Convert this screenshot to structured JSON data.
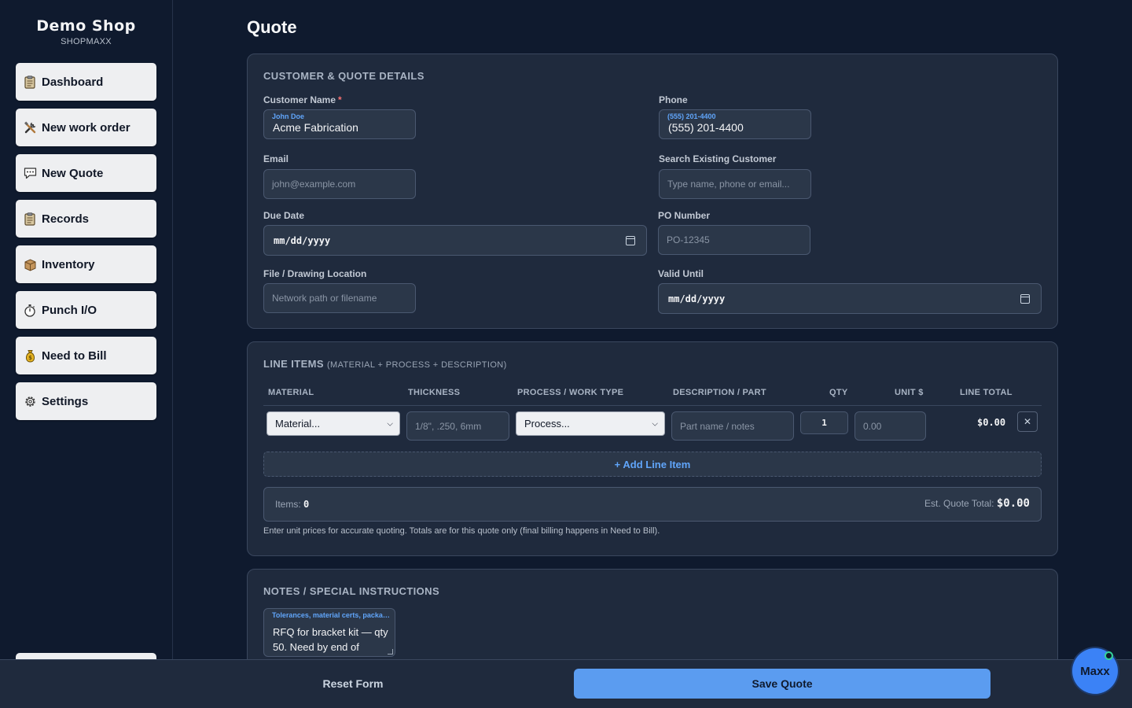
{
  "brand": {
    "title": "Demo Shop",
    "subtitle": "SHOPMAXX"
  },
  "sidebar": {
    "items": [
      {
        "label": "Dashboard",
        "icon": "clipboard-icon"
      },
      {
        "label": "New work order",
        "icon": "tools-icon"
      },
      {
        "label": "New Quote",
        "icon": "speech-bubble-icon"
      },
      {
        "label": "Records",
        "icon": "clipboard-icon"
      },
      {
        "label": "Inventory",
        "icon": "box-icon"
      },
      {
        "label": "Punch I/O",
        "icon": "stopwatch-icon"
      },
      {
        "label": "Need to Bill",
        "icon": "money-bag-icon"
      },
      {
        "label": "Settings",
        "icon": "gear-icon"
      }
    ]
  },
  "page": {
    "title": "Quote"
  },
  "customer": {
    "section_title": "CUSTOMER & QUOTE DETAILS",
    "name_label": "Customer Name",
    "required_mark": "*",
    "name_placeholder": "John Doe",
    "name_value": "Acme Fabrication",
    "phone_label": "Phone",
    "phone_placeholder": "(555) 201-4400",
    "phone_value": "(555) 201-4400",
    "email_label": "Email",
    "email_placeholder": "john@example.com",
    "search_label": "Search Existing Customer",
    "search_placeholder": "Type name, phone or email...",
    "due_label": "Due Date",
    "due_value": "mm/dd/yyyy",
    "po_label": "PO Number",
    "po_placeholder": "PO-12345",
    "file_label": "File / Drawing Location",
    "file_placeholder": "Network path or filename",
    "valid_label": "Valid Until",
    "valid_value": "mm/dd/yyyy"
  },
  "line_items": {
    "section_title": "LINE ITEMS",
    "section_sub": "(MATERIAL + PROCESS + DESCRIPTION)",
    "columns": [
      "MATERIAL",
      "THICKNESS",
      "PROCESS / WORK TYPE",
      "DESCRIPTION / PART",
      "QTY",
      "UNIT $",
      "LINE TOTAL"
    ],
    "row": {
      "material": "Material...",
      "thickness_placeholder": "1/8\", .250, 6mm",
      "process": "Process...",
      "description_placeholder": "Part name / notes",
      "qty": "1",
      "unit_placeholder": "0.00",
      "line_total": "$0.00",
      "remove": "✕"
    },
    "add_label": "+ Add Line Item",
    "items_label": "Items:",
    "items_count": "0",
    "total_label": "Est. Quote Total:",
    "total_value": "$0.00",
    "help": "Enter unit prices for accurate quoting. Totals are for this quote only (final billing happens in Need to Bill)."
  },
  "notes": {
    "section_title": "NOTES / SPECIAL INSTRUCTIONS",
    "placeholder": "Tolerances, material certs, packaging...",
    "value": "RFQ for bracket kit — qty 50. Need by end of"
  },
  "footer": {
    "reset_label": "Reset Form",
    "save_label": "Save Quote"
  },
  "assistant": {
    "label": "Maxx"
  }
}
